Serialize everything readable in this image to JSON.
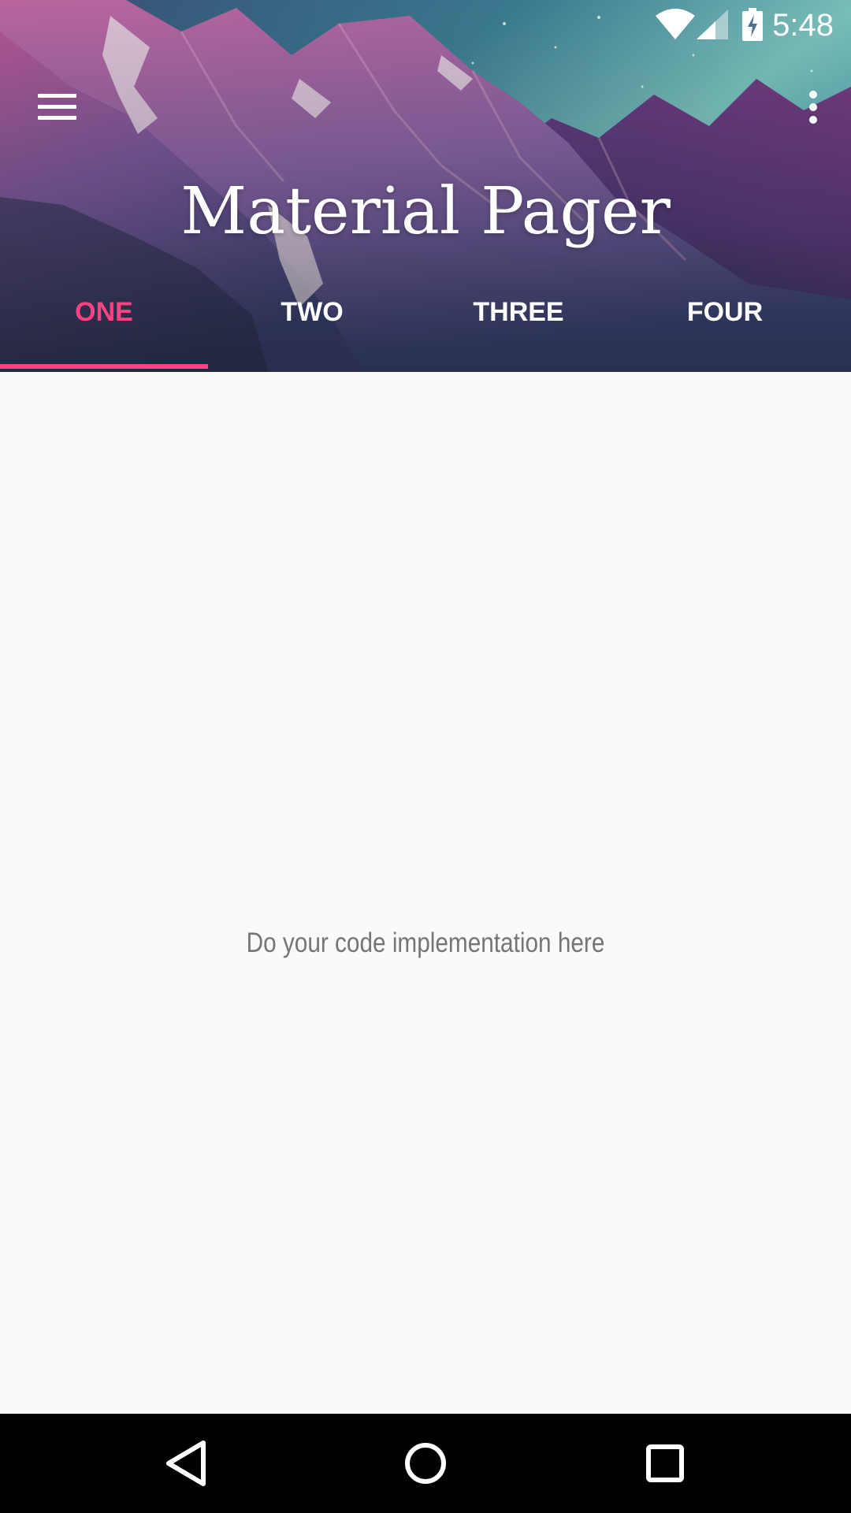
{
  "status_bar": {
    "time": "5:48",
    "icons": [
      "wifi-icon",
      "cell-signal-icon",
      "battery-charging-icon"
    ]
  },
  "toolbar": {
    "menu_icon": "hamburger-menu-icon",
    "overflow_icon": "more-vert-icon",
    "title": "Material Pager"
  },
  "tabs": [
    {
      "label": "ONE",
      "active": true
    },
    {
      "label": "TWO",
      "active": false
    },
    {
      "label": "THREE",
      "active": false
    },
    {
      "label": "FOUR",
      "active": false
    }
  ],
  "content": {
    "message": "Do your code implementation here"
  },
  "nav_bar": {
    "icons": [
      "back-icon",
      "home-icon",
      "recents-icon"
    ]
  },
  "colors": {
    "accent": "#ff4081",
    "content_background": "#fafafa",
    "content_text": "#757575",
    "nav_background": "#000000"
  }
}
